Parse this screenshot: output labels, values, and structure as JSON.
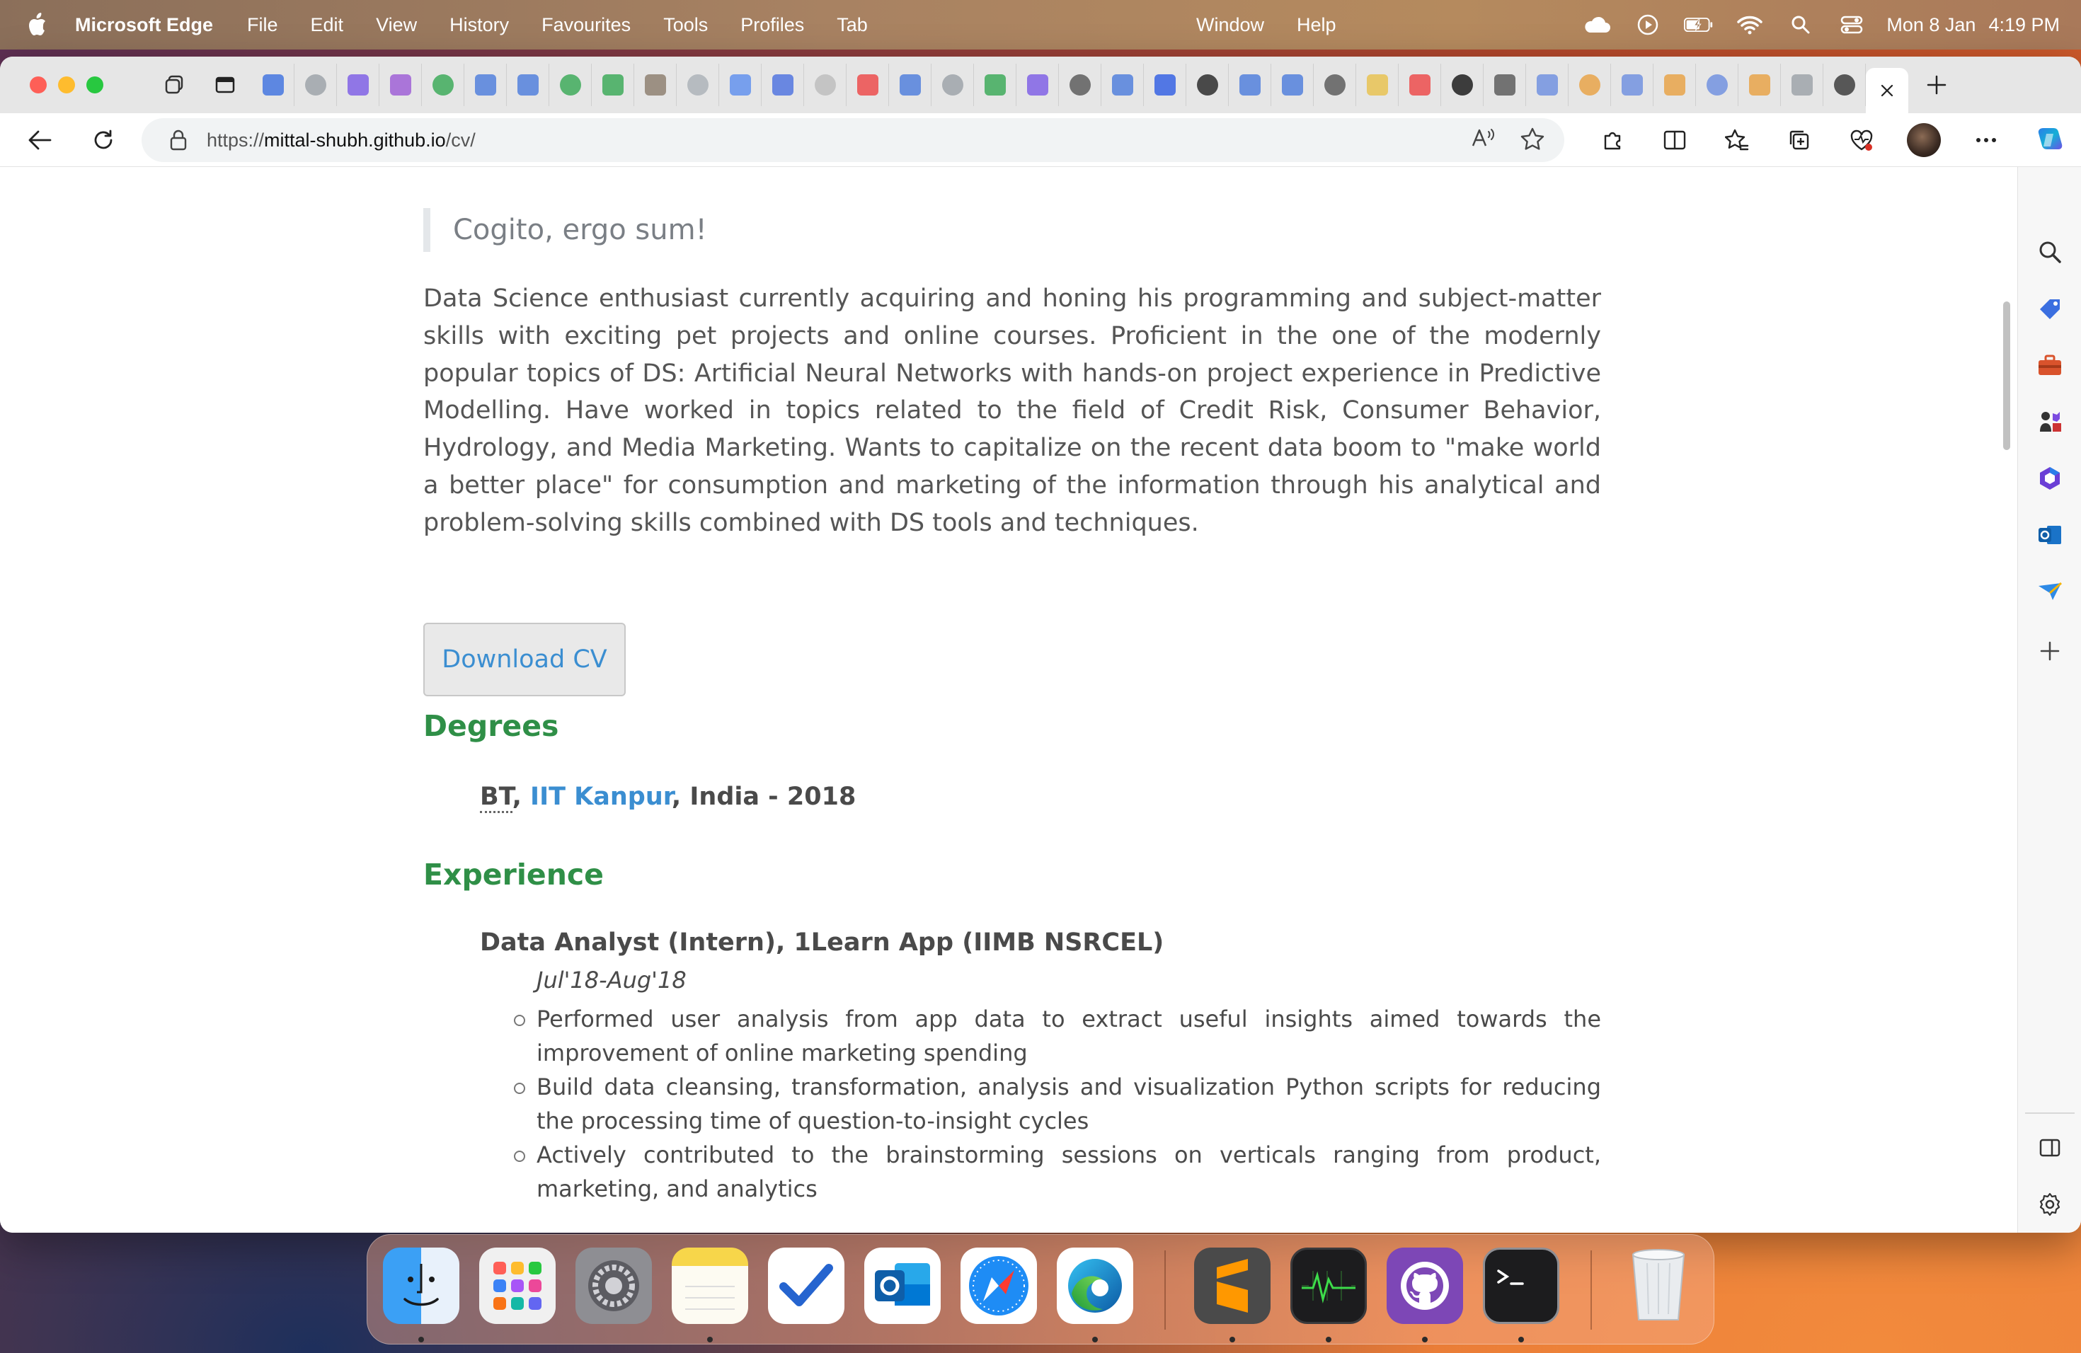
{
  "menubar": {
    "app_name": "Microsoft Edge",
    "menus": [
      "File",
      "Edit",
      "View",
      "History",
      "Favourites",
      "Tools",
      "Profiles",
      "Tab"
    ],
    "menus_right": [
      "Window",
      "Help"
    ],
    "date": "Mon 8 Jan",
    "time": "4:19 PM"
  },
  "browser": {
    "url_prefix": "https://",
    "url_host": "mittal-shubh.github.io",
    "url_path": "/cv/"
  },
  "page": {
    "quote": "Cogito, ergo sum!",
    "intro": "Data Science enthusiast currently acquiring and honing his programming and subject-matter skills with exciting pet projects and online courses. Proficient in the one of the modernly popular topics of DS: Artificial Neural Networks with hands-on project experience in Predictive Modelling. Have worked in topics related to the field of Credit Risk, Consumer Behavior, Hydrology, and Media Marketing. Wants to capitalize on the recent data boom to \"make world a better place\" for consumption and marketing of the information through his analytical and problem-solving skills combined with DS tools and techniques.",
    "download_label": "Download CV",
    "degrees_title": "Degrees",
    "degree": {
      "abbr": "BT",
      "sep1": ", ",
      "institute": "IIT Kanpur",
      "rest": ", India - 2018"
    },
    "experience_title": "Experience",
    "job": {
      "title": "Data Analyst (Intern), 1Learn App (IIMB NSRCEL)",
      "date": "Jul'18-Aug'18",
      "bullets": [
        "Performed user analysis from app data to extract useful insights aimed towards the improvement of online marketing spending",
        "Build data cleansing, transformation, analysis and visualization Python scripts for reducing the processing time of question-to-insight cycles",
        "Actively contributed to the brainstorming sessions on verticals ranging from product, marketing, and analytics"
      ]
    }
  },
  "colors": {
    "heading": "#2f8f47",
    "link": "#3b8ed1",
    "text": "#4a4a4a"
  },
  "icons": {
    "tabs": [
      "tab-actions-icon",
      "vertical-tabs-icon"
    ],
    "sidebar": [
      "search-icon",
      "shopping-tag-icon",
      "tools-icon",
      "games-icon",
      "office-icon",
      "outlook-icon",
      "send-icon",
      "add-icon",
      "split-screen-icon",
      "settings-icon"
    ],
    "dock": [
      "finder-icon",
      "launchpad-icon",
      "system-settings-icon",
      "notes-icon",
      "tasks-icon",
      "outlook-icon",
      "safari-icon",
      "edge-icon",
      "sublime-text-icon",
      "activity-monitor-icon",
      "github-desktop-icon",
      "terminal-icon",
      "trash-icon"
    ]
  }
}
